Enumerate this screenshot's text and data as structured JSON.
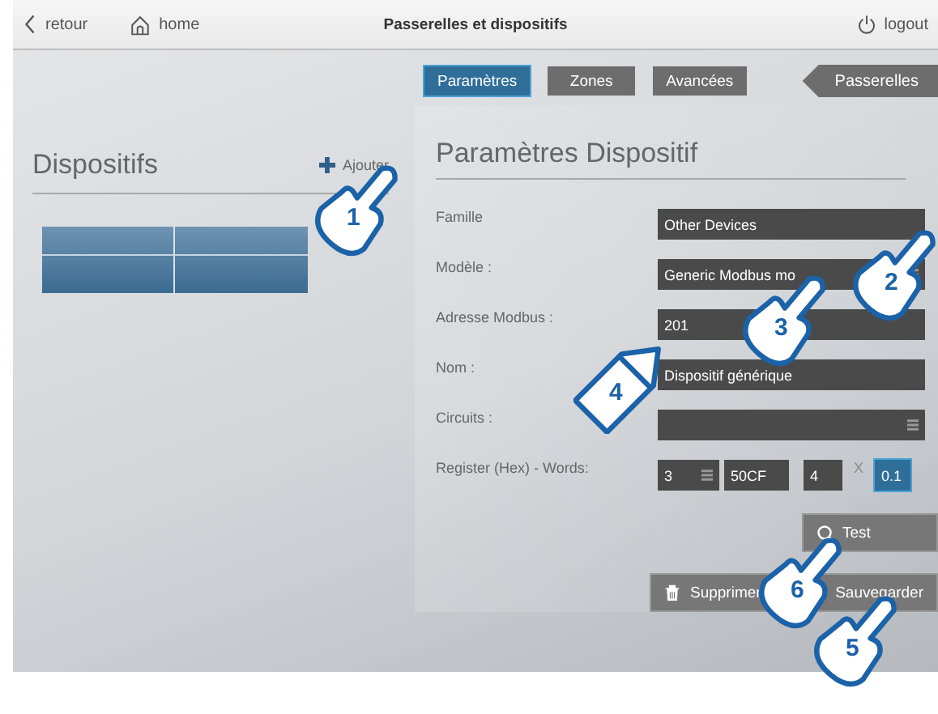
{
  "topbar": {
    "back": "retour",
    "home": "home",
    "title": "Passerelles et dispositifs",
    "logout": "logout"
  },
  "tabs": [
    {
      "label": "Paramètres",
      "selected": true
    },
    {
      "label": "Zones",
      "selected": false
    },
    {
      "label": "Avancées",
      "selected": false
    }
  ],
  "gateways_button": "Passerelles",
  "devices_panel": {
    "title": "Dispositifs",
    "add": "Ajouter"
  },
  "settings_panel": {
    "title": "Paramètres Dispositif",
    "fields": [
      {
        "label": "Famille",
        "value": "Other Devices",
        "kind": "text"
      },
      {
        "label": "Modèle :",
        "value": "Generic Modbus mo",
        "kind": "select"
      },
      {
        "label": "Adresse Modbus :",
        "value": "201",
        "kind": "text"
      },
      {
        "label": "Nom :",
        "value": "Dispositif générique",
        "kind": "text"
      },
      {
        "label": "Circuits :",
        "kind": "select"
      }
    ],
    "register": {
      "label": "Register (Hex) - Words:",
      "type": "3",
      "address": "50CF",
      "words": "4",
      "times": "X",
      "factor": "0.1"
    },
    "buttons": [
      {
        "label": "Test",
        "kind": "test"
      },
      {
        "label": "Supprimer",
        "kind": "delete"
      },
      {
        "label": "Sauvegarder",
        "kind": "save"
      }
    ]
  },
  "callouts": [
    {
      "number": "1",
      "kind": "hand"
    },
    {
      "number": "2",
      "kind": "hand"
    },
    {
      "number": "3",
      "kind": "hand"
    },
    {
      "number": "4",
      "kind": "tag"
    },
    {
      "number": "5",
      "kind": "hand"
    },
    {
      "number": "6",
      "kind": "hand"
    }
  ]
}
